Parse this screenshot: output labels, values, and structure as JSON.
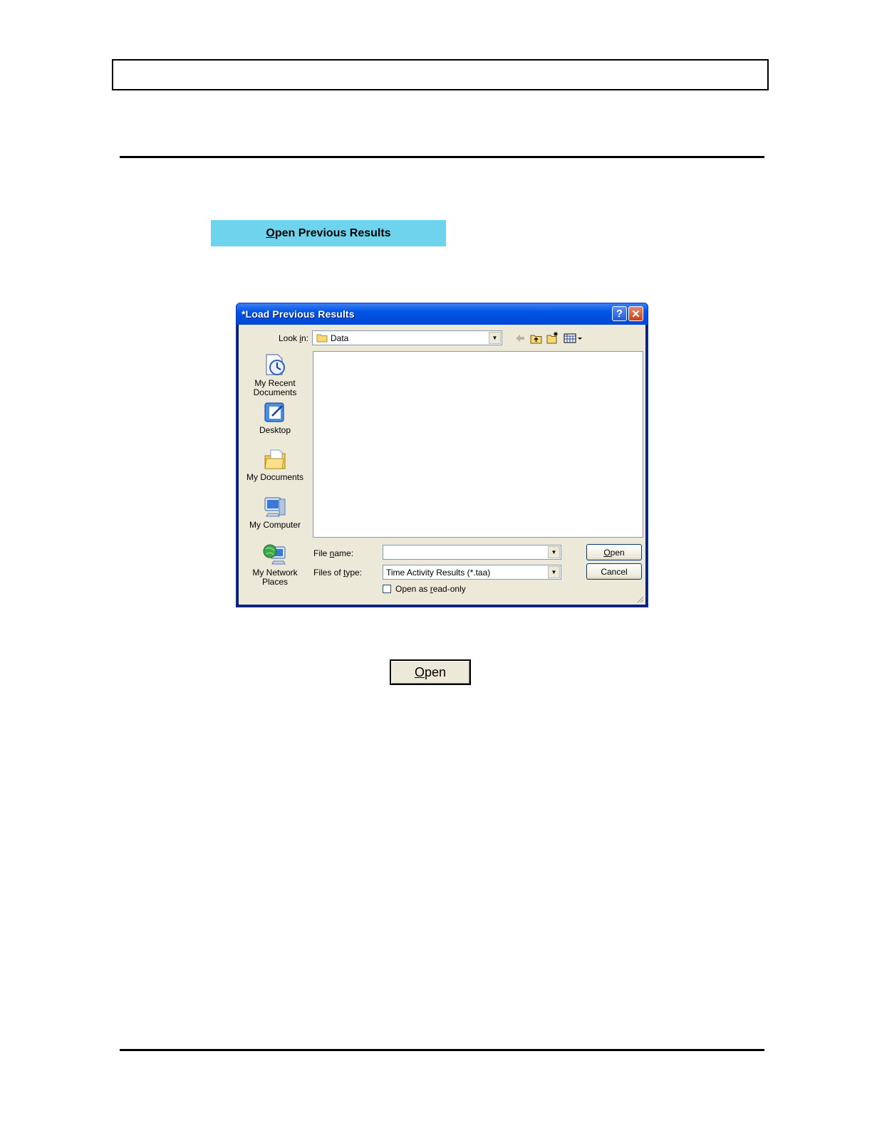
{
  "page": {
    "open_prev_button": {
      "mnemonic": "O",
      "rest": "pen Previous Results"
    },
    "big_open_button": {
      "mnemonic": "O",
      "rest": "pen"
    }
  },
  "dialog": {
    "title": "*Load Previous Results",
    "help": "?",
    "close": "✕",
    "look_in": {
      "label_pre": "Look ",
      "label_mn": "i",
      "label_post": "n:",
      "value": "Data"
    },
    "places": [
      {
        "line1": "My Recent",
        "line2": "Documents",
        "icon": "recent-documents-icon"
      },
      {
        "line1": "Desktop",
        "line2": "",
        "icon": "desktop-icon"
      },
      {
        "line1": "My Documents",
        "line2": "",
        "icon": "my-documents-icon"
      },
      {
        "line1": "My Computer",
        "line2": "",
        "icon": "my-computer-icon"
      },
      {
        "line1": "My Network",
        "line2": "Places",
        "icon": "network-places-icon"
      }
    ],
    "file_name": {
      "label_pre": "File ",
      "label_mn": "n",
      "label_post": "ame:",
      "value": ""
    },
    "files_of_type": {
      "label_pre": "Files of ",
      "label_mn": "t",
      "label_post": "ype:",
      "value": "Time Activity Results (*.taa)"
    },
    "read_only": {
      "label_pre": "Open as ",
      "label_mn": "r",
      "label_post": "ead-only"
    },
    "open_button": {
      "mnemonic": "O",
      "rest": "pen"
    },
    "cancel_button": "Cancel"
  }
}
